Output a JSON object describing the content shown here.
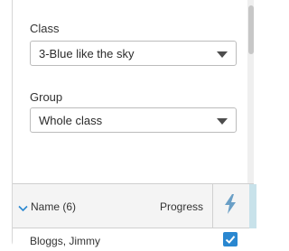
{
  "class_field": {
    "label": "Class",
    "value": "3-Blue like the sky"
  },
  "group_field": {
    "label": "Group",
    "value": "Whole class"
  },
  "table": {
    "name_header": "Name (6)",
    "progress_header": "Progress",
    "rows": [
      {
        "name": "Bloggs, Jimmy",
        "checked": true
      }
    ]
  },
  "colors": {
    "accent": "#2a87d0",
    "bolt": "#6a9fc6"
  },
  "icons": {
    "sort": "chevron-down-icon",
    "bolt": "lightning-bolt-icon",
    "check": "checkbox-checked-icon"
  }
}
